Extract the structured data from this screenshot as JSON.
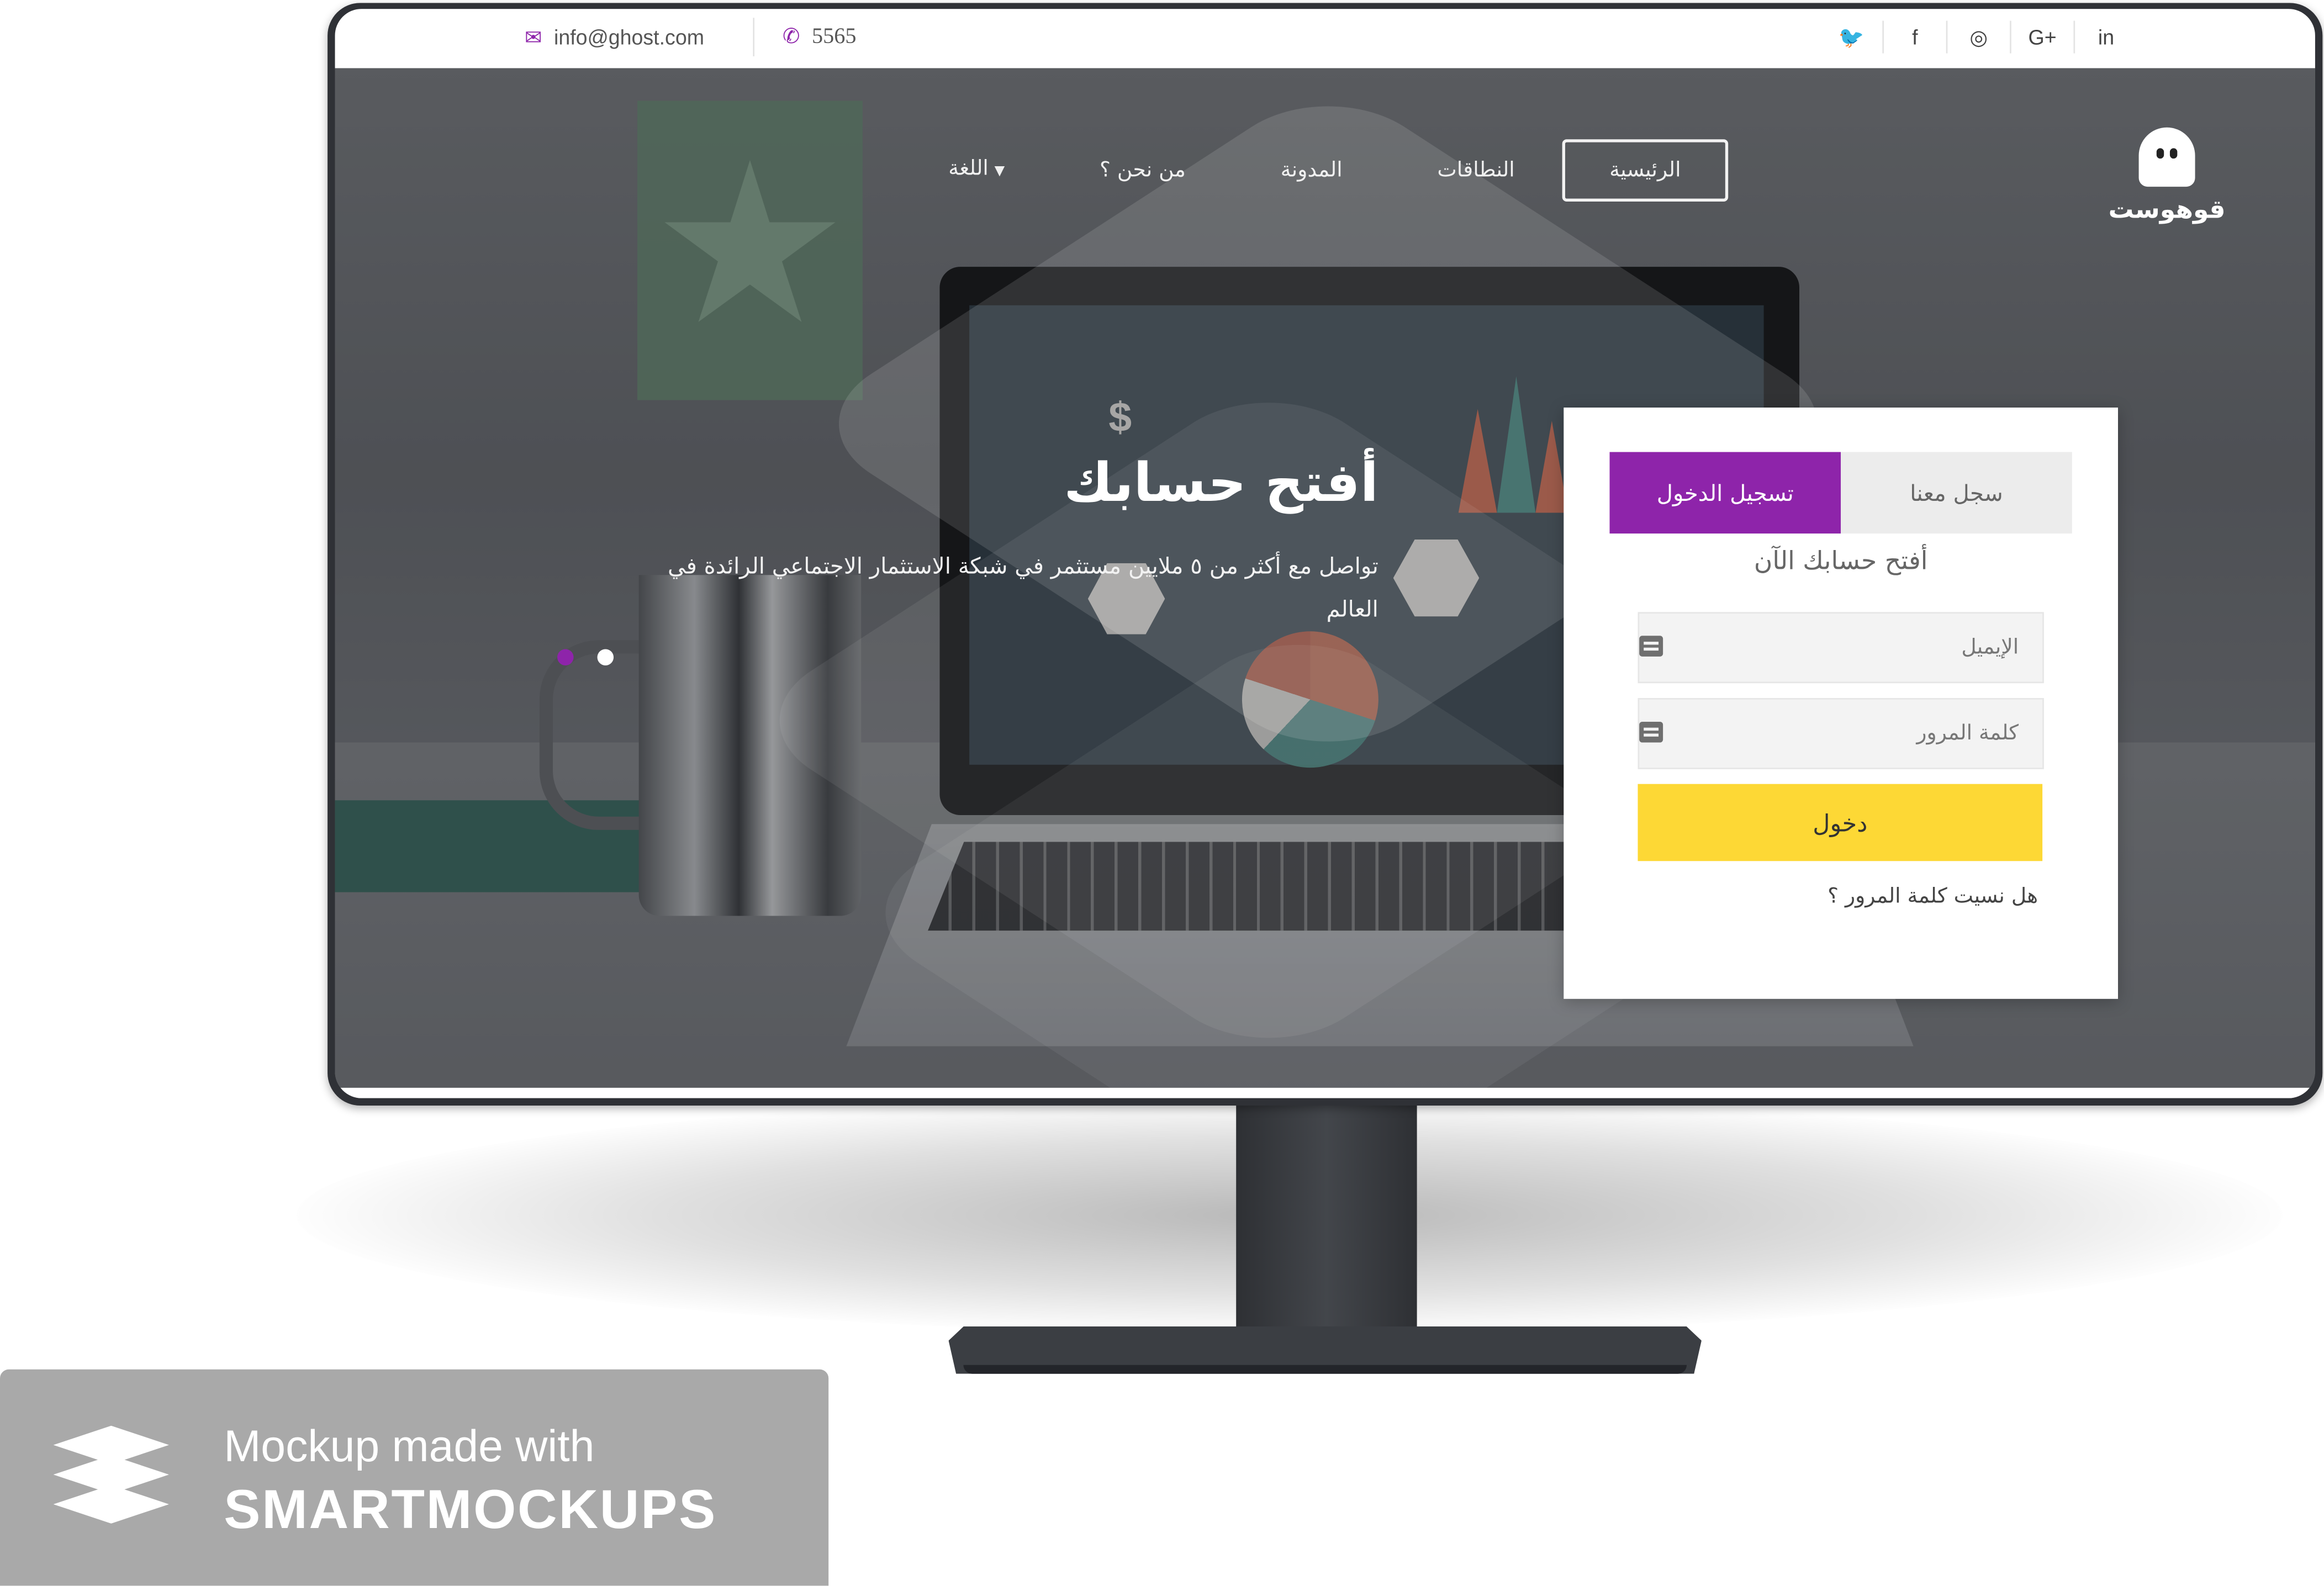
{
  "topbar": {
    "email": "info@ghost.com",
    "phone": "5565",
    "social_icons": [
      "twitter-icon",
      "facebook-icon",
      "instagram-icon",
      "google-plus-icon",
      "linkedin-icon"
    ],
    "social_glyphs": [
      "🐦",
      "f",
      "◎",
      "G+",
      "in"
    ]
  },
  "brand": {
    "logo_text": "قوهوست",
    "accent": "#8e24aa",
    "button_color": "#fdd835"
  },
  "nav": {
    "items": [
      "الرئيسية",
      "النطاقات",
      "المدونة",
      "من نحن ؟",
      "اللغة"
    ]
  },
  "hero": {
    "title": "أفتح حسابك",
    "subtitle": "تواصل مع أكثر من ٥ ملايين مستثمر في شبكة الاستثمار الاجتماعي الرائدة في العالم"
  },
  "login": {
    "tab_login": "تسجيل الدخول",
    "tab_signup": "سجل معنا",
    "title": "أفتح حسابك الآن",
    "email_placeholder": "الإيميل",
    "password_placeholder": "كلمة المرور",
    "submit_label": "دخول",
    "forgot_link": "هل نسيت كلمة المرور ؟"
  },
  "watermark": {
    "line1": "Mockup made with",
    "line2": "SMARTMOCKUPS"
  }
}
